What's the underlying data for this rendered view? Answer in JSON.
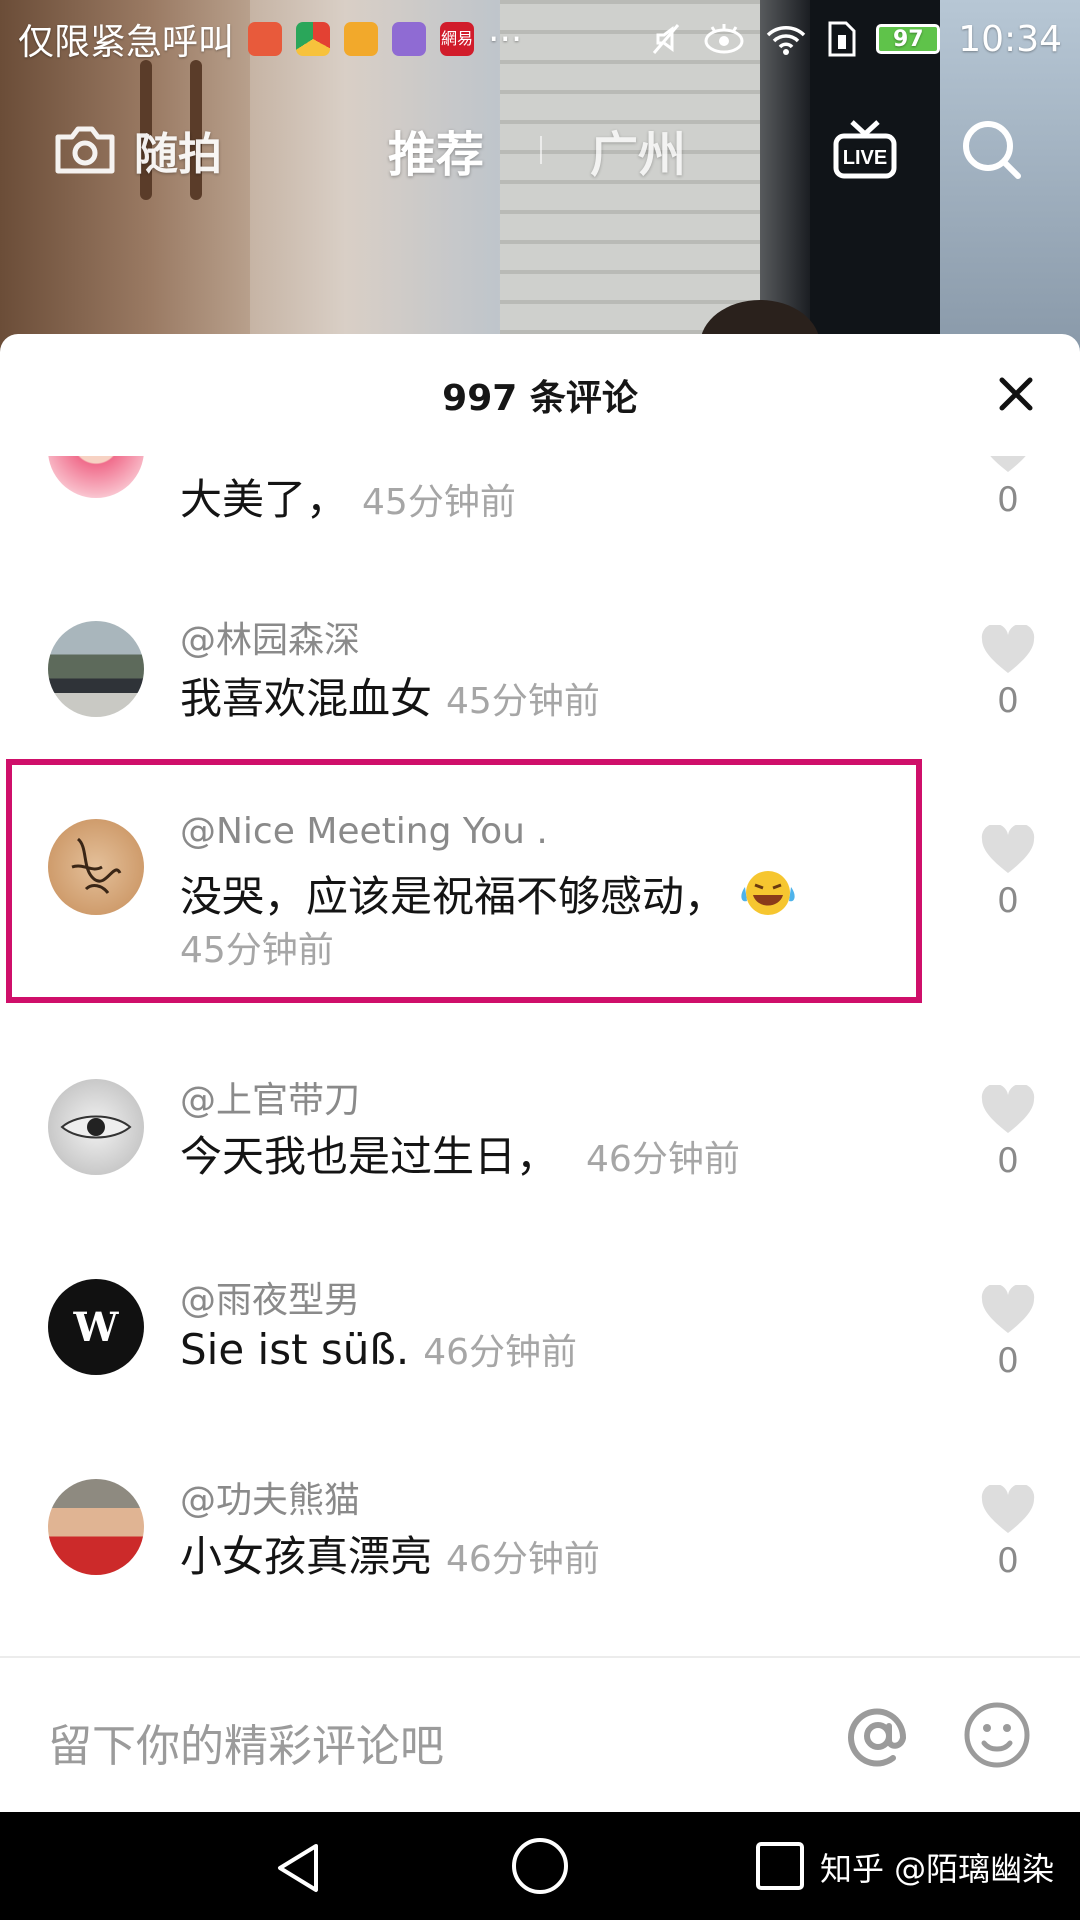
{
  "status_bar": {
    "left_text": "仅限紧急呼叫",
    "battery": "97",
    "time": "10:34",
    "app_icons": [
      "#e85a3b",
      "#e9e9e9",
      "#f2a92b",
      "#8f6bd3",
      "#d11c2b"
    ],
    "app_badge_netease": "網易"
  },
  "top_nav": {
    "capture_label": "随拍",
    "recommend_label": "推荐",
    "city_label": "广州",
    "live_label": "LIVE"
  },
  "sheet": {
    "title": "997 条评论"
  },
  "comments": [
    {
      "user": "",
      "text": "大美了，",
      "time": "45分钟前",
      "likes": "0",
      "avatar": "pink-avatar"
    },
    {
      "user": "@林园森深",
      "text": "我喜欢混血女",
      "time": "45分钟前",
      "likes": "0",
      "avatar": "street-avatar"
    },
    {
      "user": "@Nice Meeting You .",
      "text": "没哭，应该是祝福不够感动，",
      "time": "45分钟前",
      "likes": "0",
      "avatar": "calligraphy-avatar"
    },
    {
      "user": "@上官带刀",
      "text": "今天我也是过生日，",
      "time": "46分钟前",
      "likes": "0",
      "avatar": "eye-avatar"
    },
    {
      "user": "@雨夜型男",
      "text": "Sie ist süß.",
      "time": "46分钟前",
      "likes": "0",
      "avatar": "w-avatar"
    },
    {
      "user": "@功夫熊猫",
      "text": "小女孩真漂亮",
      "time": "46分钟前",
      "likes": "0",
      "avatar": "man-avatar"
    }
  ],
  "avatar_w_letter": "W",
  "input": {
    "placeholder": "留下你的精彩评论吧"
  },
  "watermark": "知乎 @陌璃幽染",
  "colors": {
    "highlight": "#cf0f6a",
    "like_heart": "#dddddd",
    "meta_text": "#8a8a8a"
  }
}
